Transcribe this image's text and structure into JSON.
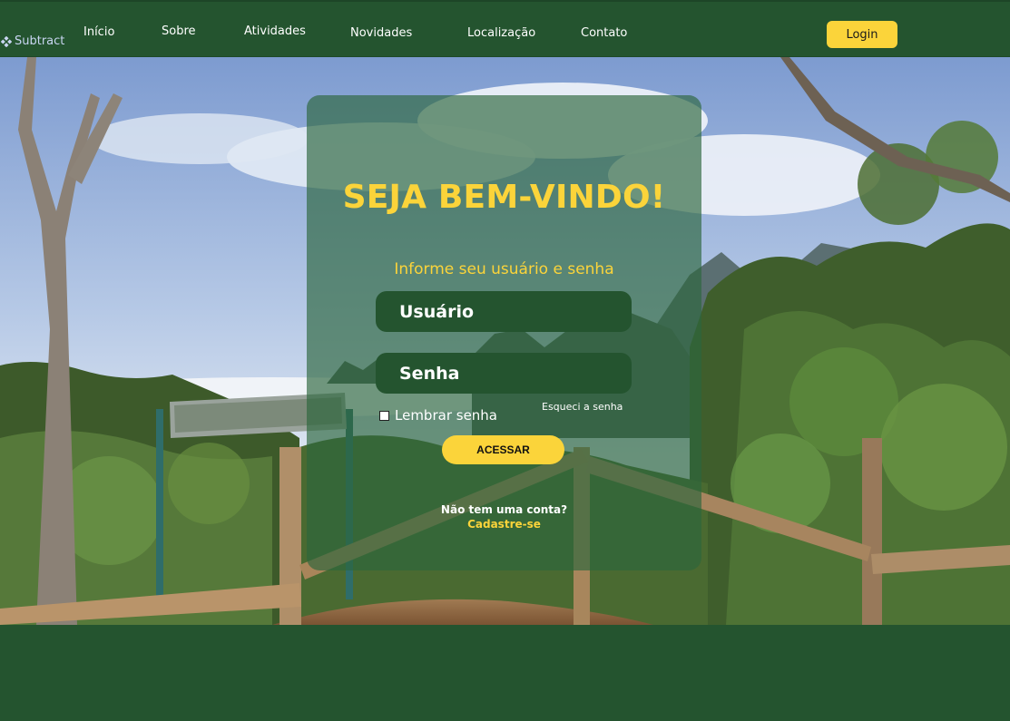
{
  "header": {
    "brand_name": "Subtract",
    "brand_icon": "cross-diamond-icon",
    "nav": [
      {
        "label": "Início"
      },
      {
        "label": "Sobre"
      },
      {
        "label": "Atividades"
      },
      {
        "label": "Novidades"
      },
      {
        "label": "Localização"
      },
      {
        "label": "Contato"
      }
    ],
    "login_label": "Login"
  },
  "login_card": {
    "title": "SEJA BEM-VINDO!",
    "subtitle": "Informe seu usuário e senha",
    "username_placeholder": "Usuário",
    "password_placeholder": "Senha",
    "remember_label": "Lembrar senha",
    "forgot_label": "Esqueci a senha",
    "submit_label": "ACESSAR",
    "no_account_text": "Não tem uma conta?",
    "signup_label": "Cadastre-se"
  },
  "colors": {
    "primary_green": "#24542f",
    "accent_yellow": "#fbd43a",
    "text_white": "#ffffff"
  }
}
